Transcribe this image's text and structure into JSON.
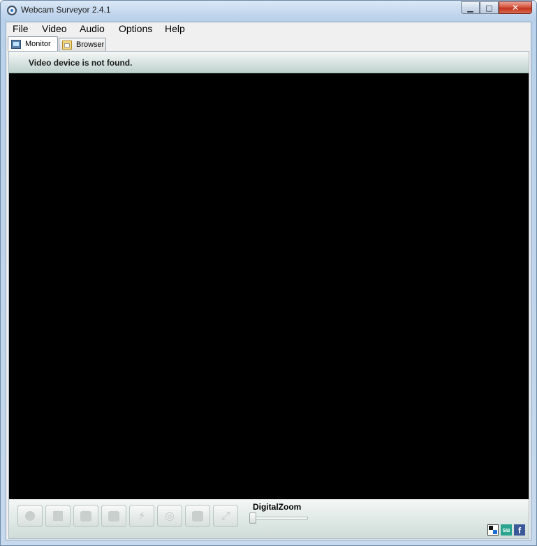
{
  "window": {
    "title": "Webcam Surveyor 2.4.1",
    "controls": {
      "minimize": "▁",
      "maximize": "□",
      "close": "✕"
    }
  },
  "menu": [
    {
      "label": "File"
    },
    {
      "label": "Video"
    },
    {
      "label": "Audio"
    },
    {
      "label": "Options"
    },
    {
      "label": "Help"
    }
  ],
  "tabs": [
    {
      "label": "Monitor",
      "active": true,
      "icon": "monitor-icon"
    },
    {
      "label": "Browser",
      "active": false,
      "icon": "browser-icon"
    }
  ],
  "monitor": {
    "status": "Video device is not found."
  },
  "controls": {
    "buttons": [
      {
        "name": "record-button",
        "icon": "record-icon"
      },
      {
        "name": "stop-button",
        "icon": "stop-icon"
      },
      {
        "name": "snapshot-button",
        "icon": "snapshot-icon"
      },
      {
        "name": "capture-button",
        "icon": "capture-icon"
      },
      {
        "name": "motion-detect-button",
        "icon": "motion-icon"
      },
      {
        "name": "broadcast-button",
        "icon": "broadcast-icon"
      },
      {
        "name": "overlay-button",
        "icon": "overlay-icon"
      },
      {
        "name": "fullscreen-button",
        "icon": "fullscreen-icon"
      }
    ],
    "zoom_label": "DigitalZoom",
    "zoom_level": 0
  },
  "social": {
    "stumbleupon": "su",
    "facebook": "f"
  },
  "colors": {
    "video_background": "#000000",
    "titlebar": "#c3d7ee",
    "close_button": "#c2351e"
  }
}
